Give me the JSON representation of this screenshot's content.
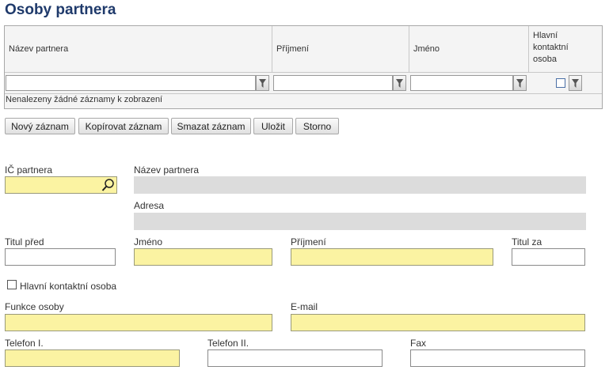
{
  "page_title": "Osoby partnera",
  "grid": {
    "columns": [
      "Název partnera",
      "Příjmení",
      "Jméno",
      "Hlavní kontaktní osoba"
    ],
    "empty_message": "Nenalezeny žádné záznamy k zobrazení"
  },
  "toolbar": {
    "new_label": "Nový záznam",
    "copy_label": "Kopírovat záznam",
    "delete_label": "Smazat záznam",
    "save_label": "Uložit",
    "cancel_label": "Storno"
  },
  "form": {
    "ic_partnera": "IČ partnera",
    "nazev_partnera": "Název partnera",
    "adresa": "Adresa",
    "titul_pred": "Titul před",
    "jmeno": "Jméno",
    "prijmeni": "Příjmení",
    "titul_za": "Titul za",
    "hlavni_kontaktni": "Hlavní kontaktní osoba",
    "funkce_osoby": "Funkce osoby",
    "email": "E-mail",
    "telefon1": "Telefon I.",
    "telefon2": "Telefon II.",
    "fax": "Fax"
  },
  "colors": {
    "title": "#1f3a6b",
    "required_field": "#fbf3a2",
    "readonly_field": "#dcdcdc"
  },
  "icons": [
    "filter-icon",
    "magnifier-icon"
  ]
}
